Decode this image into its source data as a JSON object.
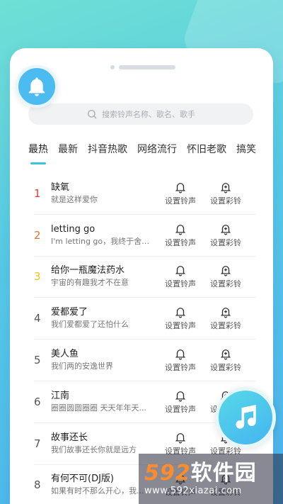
{
  "search": {
    "placeholder": "搜索铃声名称、歌名、歌手"
  },
  "tabs": [
    {
      "label": "最热"
    },
    {
      "label": "最新"
    },
    {
      "label": "抖音热歌"
    },
    {
      "label": "网络流行"
    },
    {
      "label": "怀旧老歌"
    },
    {
      "label": "搞笑"
    }
  ],
  "actions": {
    "set_ringtone": "设置铃声",
    "set_crbt": "设置彩铃"
  },
  "songs": [
    {
      "rank": "1",
      "title": "缺氧",
      "sub": "就是这样爱你"
    },
    {
      "rank": "2",
      "title": "letting go",
      "sub": "I'm letting go，我终于舍得..."
    },
    {
      "rank": "3",
      "title": "给你一瓶魔法药水",
      "sub": "宇宙的有趣我才不在意"
    },
    {
      "rank": "4",
      "title": "爱都爱了",
      "sub": "我们爱都爱了还怕什么"
    },
    {
      "rank": "5",
      "title": "美人鱼",
      "sub": "我们两的安逸世界"
    },
    {
      "rank": "6",
      "title": "江南",
      "sub": "圈圈圆圆圈圈 天天年年天..."
    },
    {
      "rank": "7",
      "title": "故事还长",
      "sub": "我们故事还长你就是远方"
    },
    {
      "rank": "8",
      "title": "有何不可(DJ版)",
      "sub": "如果有时不那么开心，我..."
    }
  ],
  "watermark": {
    "logo_num": "592",
    "logo_text": "软件园",
    "url": "www.592xiazai.com"
  },
  "colors": {
    "accent": "#3fc3d8",
    "rank1": "#e53b3b",
    "rank2": "#e8722d",
    "rank3": "#f2c21a"
  },
  "icons": [
    "bell-icon",
    "search-icon",
    "bell-outline-icon",
    "bell-plus-icon",
    "music-note-icon"
  ]
}
